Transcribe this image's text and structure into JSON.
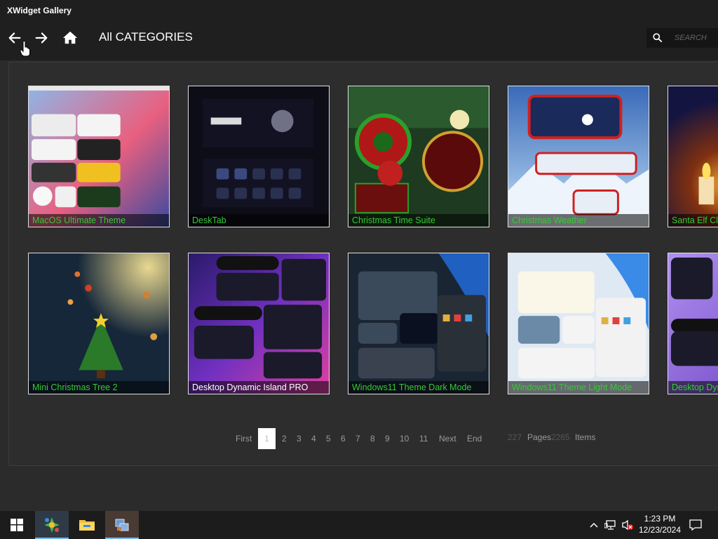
{
  "window": {
    "title": "XWidget Gallery"
  },
  "nav": {
    "title": "All CATEGORIES",
    "search_placeholder": "SEARCH"
  },
  "gallery": {
    "items": [
      {
        "name": "MacOS Ultimate Theme",
        "caption_color": "#33cc33",
        "bg": "#c5d4e8"
      },
      {
        "name": "DeskTab",
        "caption_color": "#33cc33",
        "bg": "#0d0d18"
      },
      {
        "name": "Christmas Time Suite",
        "caption_color": "#33cc33",
        "bg": "#1a3a1a"
      },
      {
        "name": "Christmas Weather",
        "caption_color": "#33cc33",
        "bg": "#3d6fb8"
      },
      {
        "name": "Santa Elf Clock",
        "caption_color": "#33cc33",
        "bg": "#151540"
      },
      {
        "name": "Mini Christmas Tree 2",
        "caption_color": "#33cc33",
        "bg": "#16273a"
      },
      {
        "name": "Desktop Dynamic Island PRO",
        "caption_color": "#ffffff",
        "bg": "#2a1a6a"
      },
      {
        "name": "Windows11 Theme Dark Mode",
        "caption_color": "#33cc33",
        "bg": "#1a2533"
      },
      {
        "name": "Windows11 Theme Light Mode",
        "caption_color": "#33cc33",
        "bg": "#dfe9f4"
      },
      {
        "name": "Desktop Dynamic Island",
        "caption_color": "#33cc33",
        "bg": "#8a70d8"
      }
    ]
  },
  "pagination": {
    "first": "First",
    "pages": [
      "1",
      "2",
      "3",
      "4",
      "5",
      "6",
      "7",
      "8",
      "9",
      "10",
      "11"
    ],
    "active_page": "1",
    "next": "Next",
    "end": "End",
    "page_count": "227",
    "pages_label": "Pages",
    "item_count": "2265",
    "items_label": "Items"
  },
  "taskbar": {
    "time": "1:23 PM",
    "date": "12/23/2024",
    "icons": [
      "windows-start-icon",
      "xwidget-icon",
      "file-explorer-icon",
      "network-tool-icon",
      "chevron-up-icon",
      "network-icon",
      "volume-muted-icon",
      "notification-icon"
    ]
  }
}
